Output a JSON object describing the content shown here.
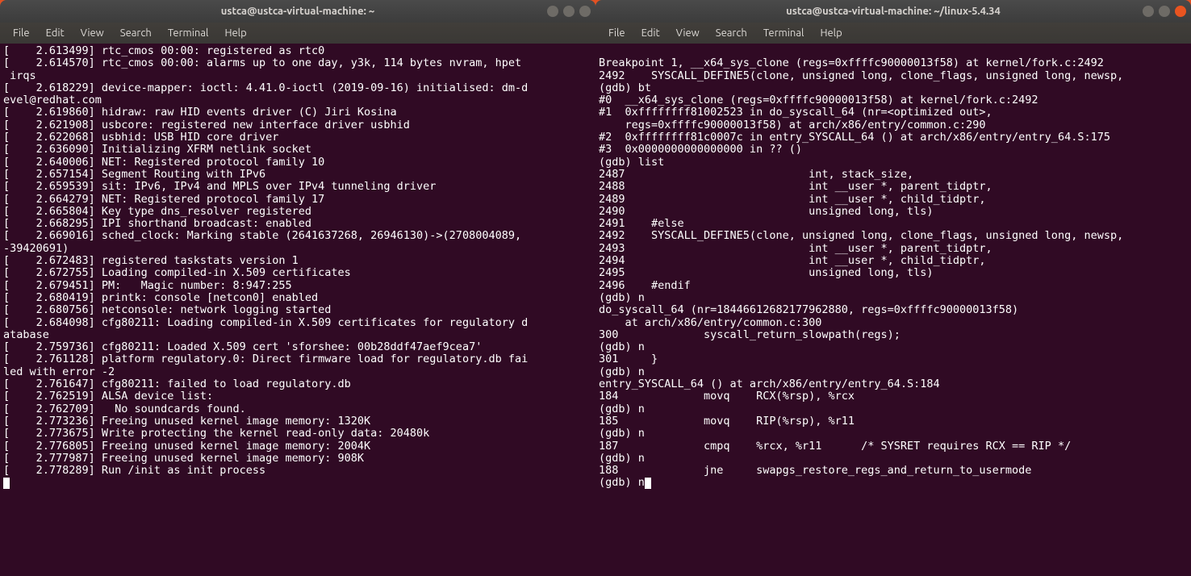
{
  "left": {
    "title": "ustca@ustca-virtual-machine: ~",
    "menu": [
      "File",
      "Edit",
      "View",
      "Search",
      "Terminal",
      "Help"
    ],
    "lines": [
      "[    2.613499] rtc_cmos 00:00: registered as rtc0",
      "[    2.614570] rtc_cmos 00:00: alarms up to one day, y3k, 114 bytes nvram, hpet",
      " irqs",
      "[    2.618229] device-mapper: ioctl: 4.41.0-ioctl (2019-09-16) initialised: dm-d",
      "evel@redhat.com",
      "[    2.619860] hidraw: raw HID events driver (C) Jiri Kosina",
      "[    2.621908] usbcore: registered new interface driver usbhid",
      "[    2.622068] usbhid: USB HID core driver",
      "[    2.636090] Initializing XFRM netlink socket",
      "[    2.640006] NET: Registered protocol family 10",
      "[    2.657154] Segment Routing with IPv6",
      "[    2.659539] sit: IPv6, IPv4 and MPLS over IPv4 tunneling driver",
      "[    2.664279] NET: Registered protocol family 17",
      "[    2.665804] Key type dns_resolver registered",
      "[    2.668295] IPI shorthand broadcast: enabled",
      "[    2.669016] sched_clock: Marking stable (2641637268, 26946130)->(2708004089, ",
      "-39420691)",
      "[    2.672483] registered taskstats version 1",
      "[    2.672755] Loading compiled-in X.509 certificates",
      "[    2.679451] PM:   Magic number: 8:947:255",
      "[    2.680419] printk: console [netcon0] enabled",
      "[    2.680756] netconsole: network logging started",
      "[    2.684098] cfg80211: Loading compiled-in X.509 certificates for regulatory d",
      "atabase",
      "[    2.759736] cfg80211: Loaded X.509 cert 'sforshee: 00b28ddf47aef9cea7'",
      "[    2.761128] platform regulatory.0: Direct firmware load for regulatory.db fai",
      "led with error -2",
      "[    2.761647] cfg80211: failed to load regulatory.db",
      "[    2.762519] ALSA device list:",
      "[    2.762709]   No soundcards found.",
      "[    2.773236] Freeing unused kernel image memory: 1320K",
      "[    2.773675] Write protecting the kernel read-only data: 20480k",
      "[    2.776805] Freeing unused kernel image memory: 2004K",
      "[    2.777987] Freeing unused kernel image memory: 908K",
      "[    2.778289] Run /init as init process"
    ]
  },
  "right": {
    "title": "ustca@ustca-virtual-machine: ~/linux-5.4.34",
    "menu": [
      "File",
      "Edit",
      "View",
      "Search",
      "Terminal",
      "Help"
    ],
    "lines": [
      "",
      "Breakpoint 1, __x64_sys_clone (regs=0xffffc90000013f58) at kernel/fork.c:2492",
      "2492    SYSCALL_DEFINE5(clone, unsigned long, clone_flags, unsigned long, newsp,",
      "(gdb) bt",
      "#0  __x64_sys_clone (regs=0xffffc90000013f58) at kernel/fork.c:2492",
      "#1  0xffffffff81002523 in do_syscall_64 (nr=<optimized out>, ",
      "    regs=0xffffc90000013f58) at arch/x86/entry/common.c:290",
      "#2  0xffffffff81c0007c in entry_SYSCALL_64 () at arch/x86/entry/entry_64.S:175",
      "#3  0x0000000000000000 in ?? ()",
      "(gdb) list",
      "2487                            int, stack_size,",
      "2488                            int __user *, parent_tidptr,",
      "2489                            int __user *, child_tidptr,",
      "2490                            unsigned long, tls)",
      "2491    #else",
      "2492    SYSCALL_DEFINE5(clone, unsigned long, clone_flags, unsigned long, newsp,",
      "2493                            int __user *, parent_tidptr,",
      "2494                            int __user *, child_tidptr,",
      "2495                            unsigned long, tls)",
      "2496    #endif",
      "(gdb) n",
      "do_syscall_64 (nr=18446612682177962880, regs=0xffffc90000013f58)",
      "    at arch/x86/entry/common.c:300",
      "300             syscall_return_slowpath(regs);",
      "(gdb) n",
      "301     }",
      "(gdb) n",
      "entry_SYSCALL_64 () at arch/x86/entry/entry_64.S:184",
      "184             movq    RCX(%rsp), %rcx",
      "(gdb) n",
      "185             movq    RIP(%rsp), %r11",
      "(gdb) n",
      "187             cmpq    %rcx, %r11      /* SYSRET requires RCX == RIP */",
      "(gdb) n",
      "188             jne     swapgs_restore_regs_and_return_to_usermode",
      "(gdb) n"
    ]
  }
}
